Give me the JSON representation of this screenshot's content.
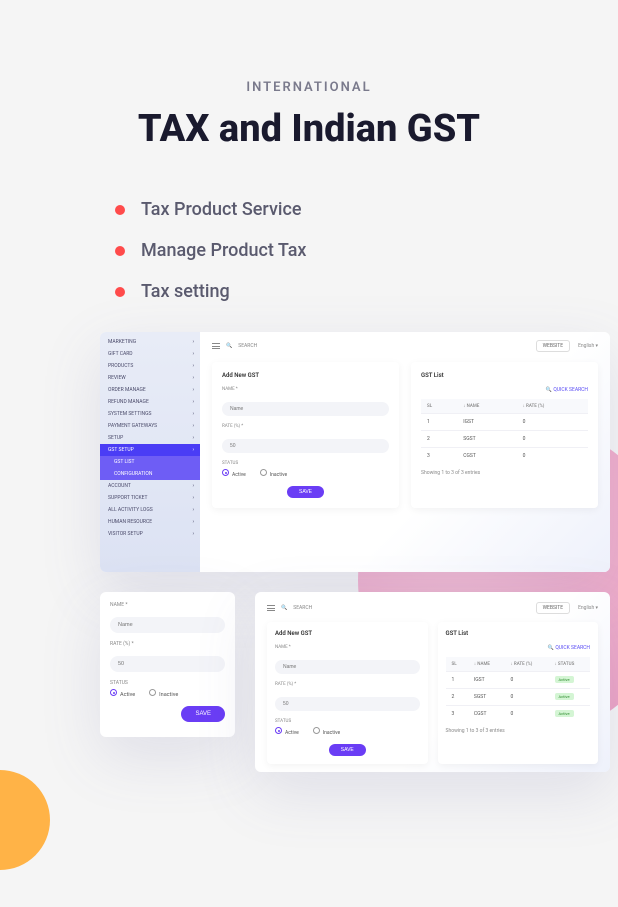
{
  "kicker": "INTERNATIONAL",
  "headline": "TAX and Indian GST",
  "features": [
    "Tax Product Service",
    "Manage Product Tax",
    "Tax setting"
  ],
  "topbar": {
    "search": "SEARCH",
    "website_btn": "WEBSITE",
    "language": "English"
  },
  "sidebar": {
    "items": [
      "MARKETING",
      "GIFT CARD",
      "PRODUCTS",
      "REVIEW",
      "ORDER MANAGE",
      "REFUND MANAGE",
      "SYSTEM SETTINGS",
      "PAYMENT GATEWAYS",
      "SETUP",
      "GST SETUP",
      "GST LIST",
      "CONFIGURATION",
      "ACCOUNT",
      "SUPPORT TICKET",
      "ALL ACTIVITY LOGS",
      "HUMAN RESOURCE",
      "VISITOR SETUP"
    ]
  },
  "form": {
    "title": "Add New GST",
    "name_label": "NAME *",
    "name_placeholder": "Name",
    "rate_label": "RATE (%) *",
    "rate_placeholder": "50",
    "status_label": "STATUS",
    "active": "Active",
    "inactive": "Inactive",
    "save": "SAVE"
  },
  "list": {
    "title": "GST List",
    "quick_search": "QUICK SEARCH",
    "cols": {
      "sl": "SL",
      "name": "NAME",
      "rate": "RATE (%)",
      "status": "STATUS"
    },
    "rows": [
      {
        "sl": "1",
        "name": "IGST",
        "rate": "0",
        "status": "Active"
      },
      {
        "sl": "2",
        "name": "SGST",
        "rate": "0",
        "status": "Active"
      },
      {
        "sl": "3",
        "name": "CGST",
        "rate": "0",
        "status": "Active"
      }
    ],
    "showing": "Showing 1 to 3 of 3 entries"
  }
}
